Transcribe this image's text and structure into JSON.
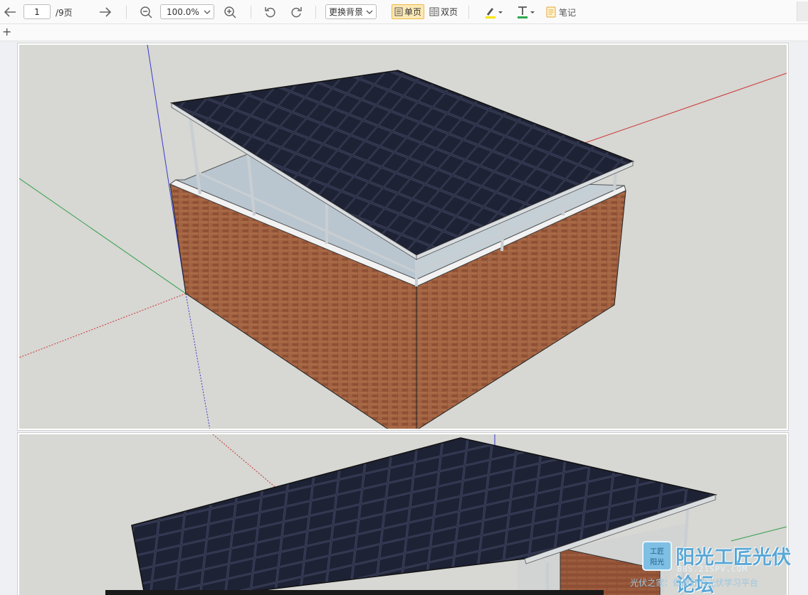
{
  "toolbar": {
    "page_current": "1",
    "page_total": "/9页",
    "zoom_value": "100.0%",
    "background_label": "更换背景",
    "single_page_label": "单页",
    "double_page_label": "双页",
    "notes_label": "笔记",
    "highlight_color": "#f7e600",
    "text_color": "#2fa84f"
  },
  "subbar": {
    "add_label": "+"
  },
  "watermark": {
    "logo_text_top": "工匠",
    "logo_text_bottom": "阳光",
    "title": "阳光工匠光伏论坛",
    "url": "BBS.21SPV.COM",
    "slogan": "光伏之家：做最好的光伏学习平台"
  },
  "colors": {
    "axis_red": "#cc3333",
    "axis_green": "#2ea04a",
    "axis_blue": "#3a3acc",
    "brick": "#9b5b3a",
    "panel": "#1f2336"
  }
}
